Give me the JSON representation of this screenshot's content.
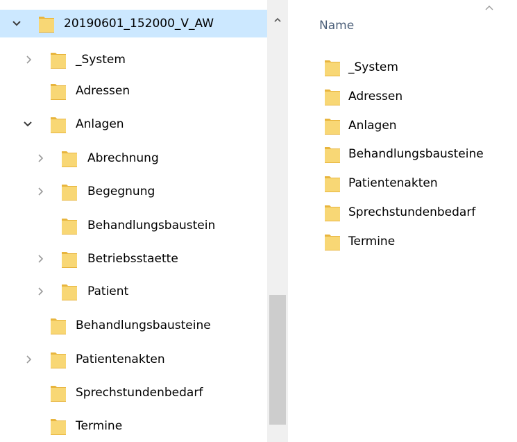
{
  "nav": {
    "items": [
      {
        "label": "20190601_152000_V_AW",
        "level": 0,
        "chevron": "down",
        "selected": true
      },
      {
        "label": "_System",
        "level": 1,
        "chevron": "right"
      },
      {
        "label": "Adressen",
        "level": 1,
        "chevron": "none"
      },
      {
        "label": "Anlagen",
        "level": 1,
        "chevron": "down"
      },
      {
        "label": "Abrechnung",
        "level": 2,
        "chevron": "right"
      },
      {
        "label": "Begegnung",
        "level": 2,
        "chevron": "right"
      },
      {
        "label": "Behandlungsbaustein",
        "level": 2,
        "chevron": "none"
      },
      {
        "label": "Betriebsstaette",
        "level": 2,
        "chevron": "right"
      },
      {
        "label": "Patient",
        "level": 2,
        "chevron": "right"
      },
      {
        "label": "Behandlungsbausteine",
        "level": 1,
        "chevron": "none"
      },
      {
        "label": "Patientenakten",
        "level": 1,
        "chevron": "right"
      },
      {
        "label": "Sprechstundenbedarf",
        "level": 1,
        "chevron": "none"
      },
      {
        "label": "Termine",
        "level": 1,
        "chevron": "none"
      }
    ]
  },
  "content": {
    "column_header": "Name",
    "items": [
      "_System",
      "Adressen",
      "Anlagen",
      "Behandlungsbausteine",
      "Patientenakten",
      "Sprechstundenbedarf",
      "Termine"
    ]
  },
  "colors": {
    "selection": "#cce8ff",
    "folder_body": "#f8d775",
    "folder_tab": "#e8b53e",
    "header_text": "#4c607a",
    "scrollbar_track": "#f0f0f0",
    "scrollbar_thumb": "#cdcdcd"
  }
}
